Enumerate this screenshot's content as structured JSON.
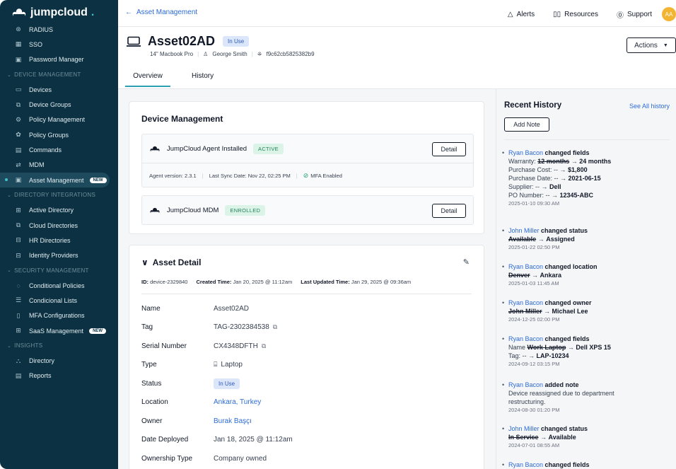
{
  "app": {
    "brand": "jumpcloud",
    "brand_suffix": "."
  },
  "sidebar": {
    "top_items": [
      {
        "label": "RADIUS",
        "icon": "radius-icon"
      },
      {
        "label": "SSO",
        "icon": "grid-icon"
      },
      {
        "label": "Password Manager",
        "icon": "vault-icon"
      }
    ],
    "sections": [
      {
        "title": "DEVICE MANAGEMENT",
        "items": [
          {
            "label": "Devices",
            "icon": "laptop-icon"
          },
          {
            "label": "Device Groups",
            "icon": "device-group-icon"
          },
          {
            "label": "Policy Management",
            "icon": "policy-icon"
          },
          {
            "label": "Policy Groups",
            "icon": "policy-group-icon"
          },
          {
            "label": "Commands",
            "icon": "terminal-icon"
          },
          {
            "label": "MDM",
            "icon": "mdm-icon"
          },
          {
            "label": "Asset Management",
            "icon": "asset-icon",
            "badge": "NEW",
            "active": true
          }
        ]
      },
      {
        "title": "DIRECTORY INTEGRATIONS",
        "items": [
          {
            "label": "Active Directory",
            "icon": "ad-icon"
          },
          {
            "label": "Cloud Directories",
            "icon": "cloud-dir-icon"
          },
          {
            "label": "HR Directories",
            "icon": "hr-icon"
          },
          {
            "label": "Identity Providers",
            "icon": "idp-icon"
          }
        ]
      },
      {
        "title": "SECURITY MANAGEMENT",
        "items": [
          {
            "label": "Conditional Policies",
            "icon": "conditional-icon"
          },
          {
            "label": "Condicional Lists",
            "icon": "list-icon"
          },
          {
            "label": "MFA Configurations",
            "icon": "mfa-icon"
          },
          {
            "label": "SaaS Management",
            "icon": "saas-icon",
            "badge": "NEW"
          }
        ]
      },
      {
        "title": "INSIGHTS",
        "items": [
          {
            "label": "Directory",
            "icon": "directory-icon"
          },
          {
            "label": "Reports",
            "icon": "reports-icon"
          }
        ]
      }
    ]
  },
  "topbar": {
    "back_label": "Asset Management",
    "alerts": "Alerts",
    "resources": "Resources",
    "support": "Support",
    "avatar": "AA"
  },
  "asset": {
    "name": "Asset02AD",
    "status": "In Use",
    "model": "14\" Macbook Pro",
    "owner": "George Smith",
    "hash": "f9c62cb5825382b9",
    "actions_label": "Actions",
    "tabs": [
      "Overview",
      "History"
    ]
  },
  "device_management": {
    "title": "Device Management",
    "agent": {
      "name": "JumpCloud Agent Installed",
      "status": "ACTIVE",
      "detail_label": "Detail",
      "version_label": "Agent version:",
      "version": "2.3.1",
      "sync_label": "Last Sync Date:",
      "sync": "Nov 22, 02:25 PM",
      "mfa": "MFA Enabled"
    },
    "mdm": {
      "name": "JumpCloud MDM",
      "status": "ENROLLED",
      "detail_label": "Detail"
    }
  },
  "asset_detail": {
    "title": "Asset Detail",
    "id_label": "ID:",
    "id": "device-2329840",
    "created_label": "Created Time:",
    "created": "Jan 20, 2025 @ 11:12am",
    "updated_label": "Last Updated Time:",
    "updated": "Jan 29, 2025 @ 09:36am",
    "fields": [
      {
        "label": "Name",
        "value": "Asset02AD"
      },
      {
        "label": "Tag",
        "value": "TAG-2302384538"
      },
      {
        "label": "Serial Number",
        "value": "CX4348DFTH"
      },
      {
        "label": "Type",
        "value": "Laptop"
      },
      {
        "label": "Status",
        "value": "In Use"
      },
      {
        "label": "Location",
        "value": "Ankara, Turkey"
      },
      {
        "label": "Owner",
        "value": "Burak Başçı"
      },
      {
        "label": "Date Deployed",
        "value": "Jan 18, 2025 @ 11:12am"
      },
      {
        "label": "Ownership Type",
        "value": "Company owned"
      }
    ]
  },
  "history": {
    "title": "Recent History",
    "see_all": "See All history",
    "add_note": "Add Note",
    "entries": [
      {
        "who": "Ryan Bacon",
        "action": "changed fields",
        "ts": "2025-01-10 09:30 AM",
        "l1a": "Warranty:",
        "l1old": "12 months",
        "l1new": "24 months",
        "l2a": "Purchase Cost: --",
        "l2new": "$1,800",
        "l3a": "Purchase Date: --",
        "l3new": "2021-06-15",
        "l4a": "Supplier: --",
        "l4new": "Dell",
        "l5a": "PO Number: --",
        "l5new": "12345-ABC"
      },
      {
        "who": "John Miller",
        "action": "changed status",
        "old": "Available",
        "new": "Assigned",
        "ts": "2025-01-22 02:50 PM"
      },
      {
        "who": "Ryan Bacon",
        "action": "changed location",
        "old": "Denver",
        "new": "Ankara",
        "ts": "2025-01-03 11:45 AM"
      },
      {
        "who": "Ryan Bacon",
        "action": "changed owner",
        "old": "John Miller",
        "new": "Michael Lee",
        "ts": "2024-12-25 02:00 PM"
      },
      {
        "who": "Ryan Bacon",
        "action": "changed fields",
        "l1a": "Name",
        "l1old": "Work Laptop",
        "l1new": "Dell XPS 15",
        "l2a": "Tag: --",
        "l2new": "LAP-10234",
        "ts": "2024-09-12 03:15 PM"
      },
      {
        "who": "Ryan Bacon",
        "action": "added note",
        "note": "Device reassigned due to department restructuring.",
        "ts": "2024-08-30 01:20 PM"
      },
      {
        "who": "John Miller",
        "action": "changed status",
        "old": "In Service",
        "new": "Available",
        "ts": "2024-07-01 08:55 AM"
      },
      {
        "who": "Ryan Bacon",
        "action": "changed fields"
      }
    ]
  }
}
